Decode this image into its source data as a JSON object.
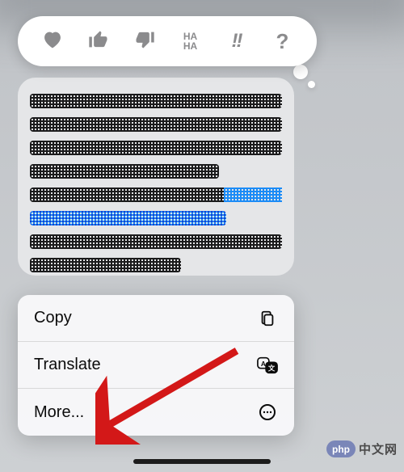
{
  "reactions": {
    "heart_name": "heart-icon",
    "thumbs_up_name": "thumbs-up-icon",
    "thumbs_down_name": "thumbs-down-icon",
    "haha_label": "HA\nHA",
    "exclaim_label": "!!",
    "question_label": "?"
  },
  "message": {
    "content_status": "redacted"
  },
  "menu": {
    "copy_label": "Copy",
    "translate_label": "Translate",
    "more_label": "More..."
  },
  "watermark": {
    "badge_text": "php",
    "site_text": "中文网"
  }
}
